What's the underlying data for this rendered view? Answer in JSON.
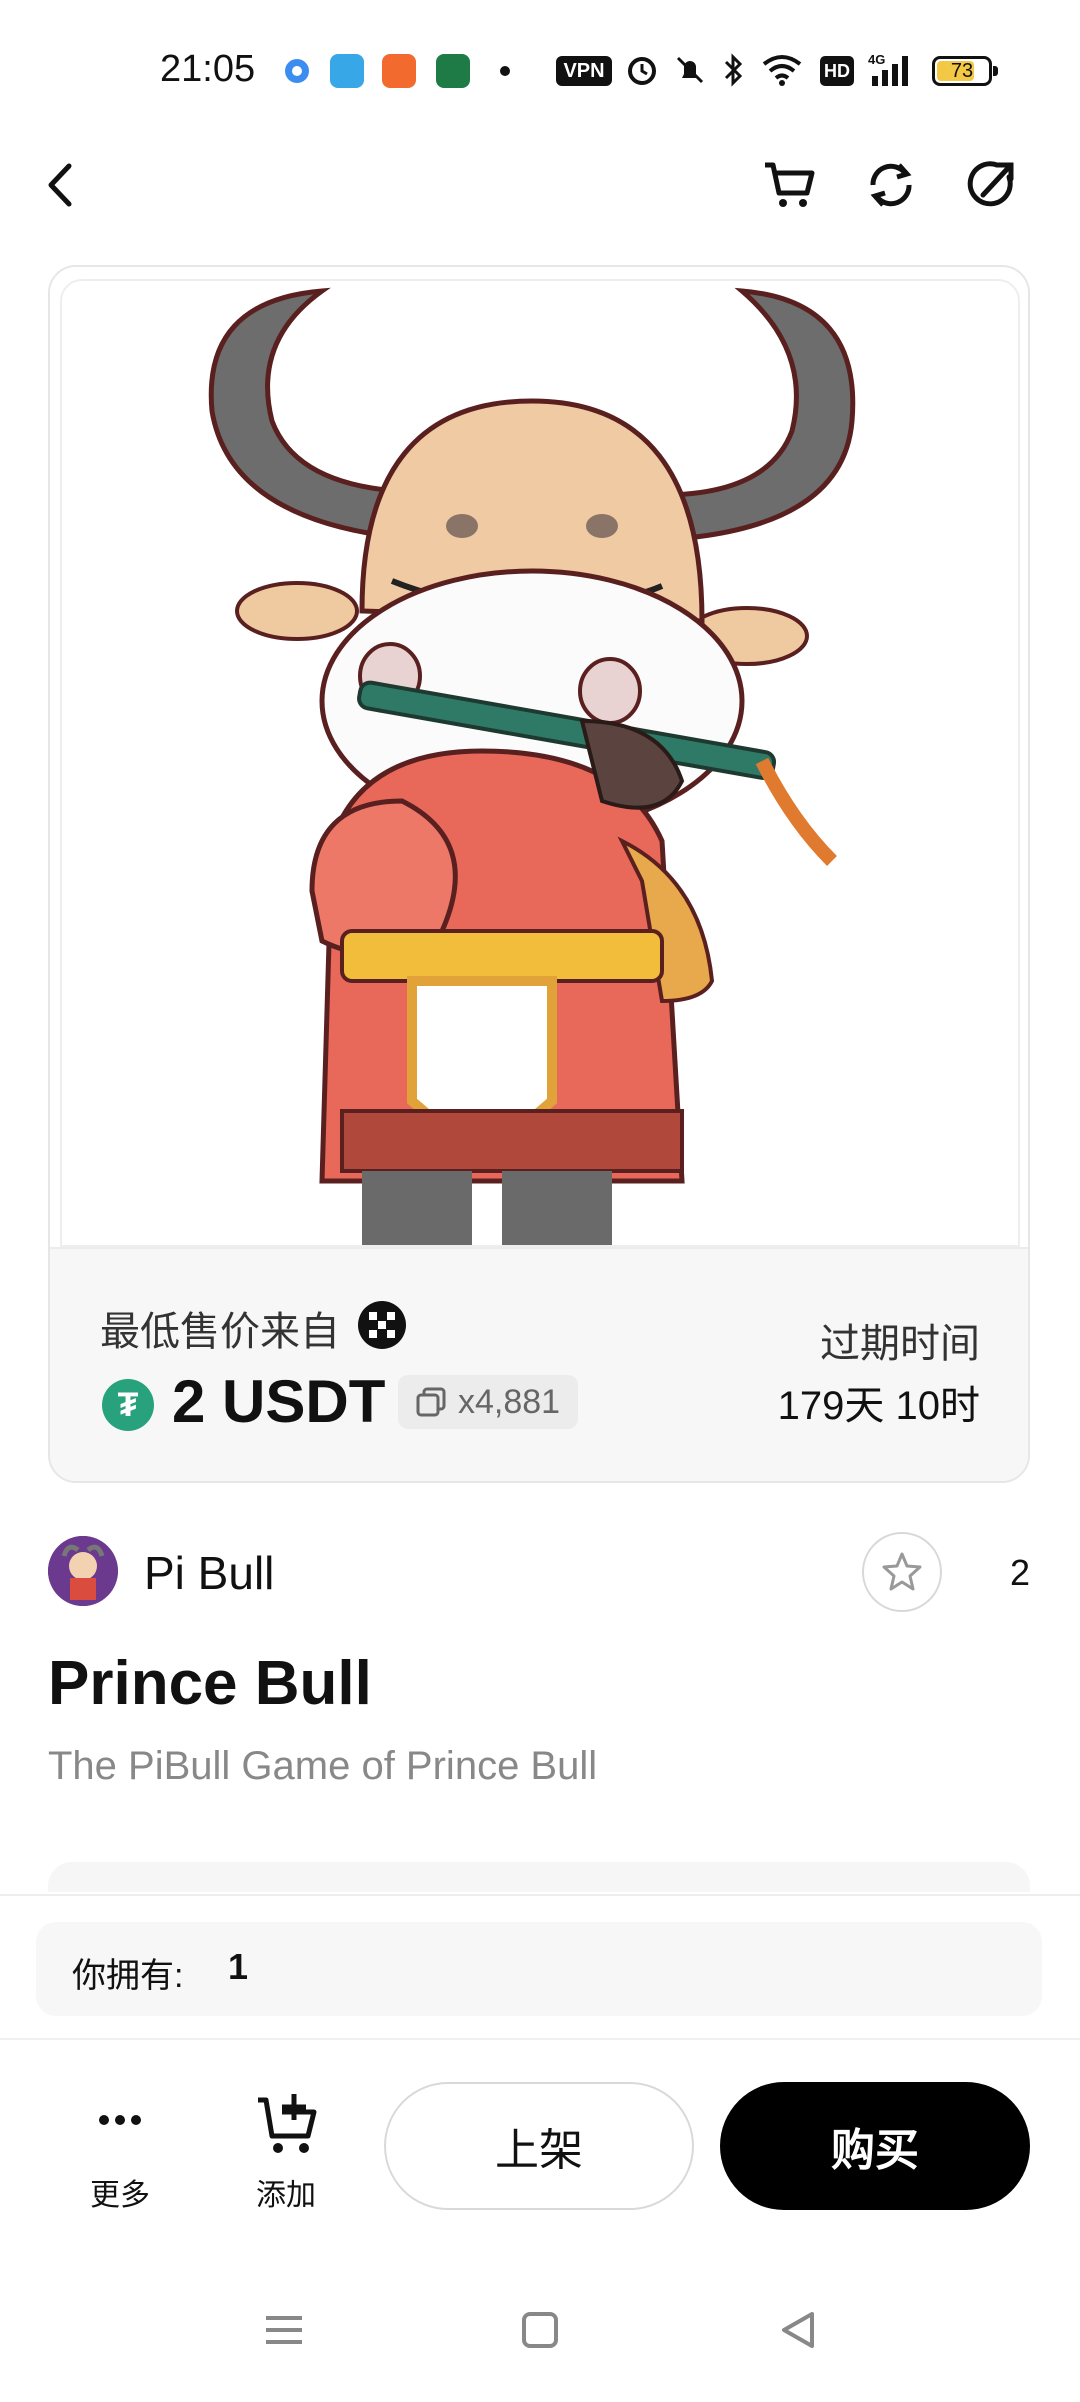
{
  "status_bar": {
    "time": "21:05",
    "vpn": "VPN",
    "hd": "HD",
    "network": "4G",
    "battery": "73",
    "battery_level": 0.73
  },
  "nav": {
    "back_icon": "chevron-left-icon",
    "cart_icon": "cart-icon",
    "refresh_icon": "refresh-icon",
    "share_icon": "share-icon"
  },
  "listing": {
    "lowest_price_label": "最低售价来自",
    "currency_icon": "usdt-icon",
    "price": "2 USDT",
    "copies": "x4,881",
    "expiry_label": "过期时间",
    "expiry_value": "179天 10时"
  },
  "creator": {
    "name": "Pi Bull",
    "favorites": "2"
  },
  "item": {
    "title": "Prince Bull",
    "description": "The PiBull Game of Prince Bull"
  },
  "bottom": {
    "owned_label": "你拥有:",
    "owned_value": "1",
    "more_label": "更多",
    "add_label": "添加",
    "list_label": "上架",
    "buy_label": "购买"
  },
  "colors": {
    "accent": "#000000",
    "usdt": "#28a17d",
    "battery": "#f3c844"
  }
}
